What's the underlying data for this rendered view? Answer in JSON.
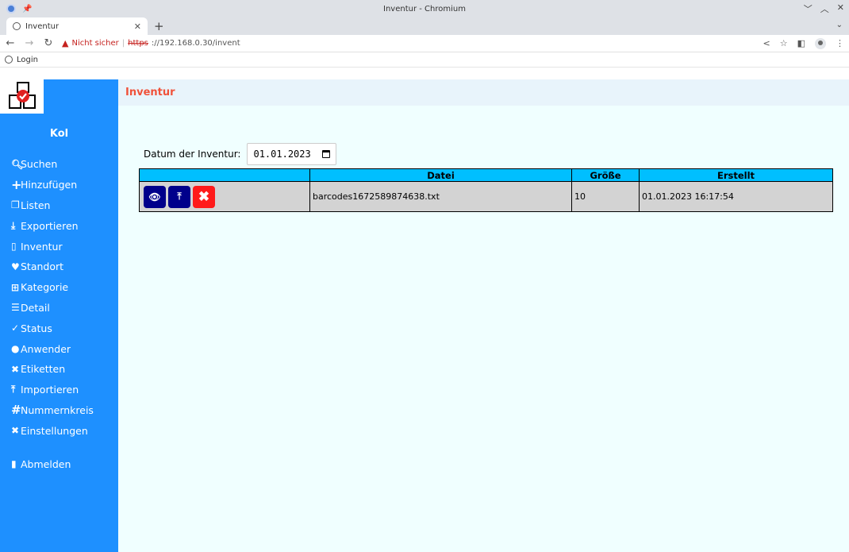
{
  "browser": {
    "window_title": "Inventur - Chromium",
    "tab_title": "Inventur",
    "not_secure": "Nicht sicher",
    "url_proto": "https",
    "url_rest": "://192.168.0.30/invent",
    "bookmark": "Login"
  },
  "sidebar": {
    "user": "Kol",
    "items": [
      {
        "label": "Suchen",
        "icon": "search-icon"
      },
      {
        "label": "Hinzufügen",
        "icon": "plus-icon"
      },
      {
        "label": "Listen",
        "icon": "copy-icon"
      },
      {
        "label": "Exportieren",
        "icon": "download-icon"
      },
      {
        "label": "Inventur",
        "icon": "clipboard-icon"
      },
      {
        "label": "Standort",
        "icon": "map-pin-icon"
      },
      {
        "label": "Kategorie",
        "icon": "grid-icon"
      },
      {
        "label": "Detail",
        "icon": "list-icon"
      },
      {
        "label": "Status",
        "icon": "check-icon"
      },
      {
        "label": "Anwender",
        "icon": "user-icon"
      },
      {
        "label": "Etiketten",
        "icon": "tools-icon"
      },
      {
        "label": "Importieren",
        "icon": "upload-icon"
      },
      {
        "label": "Nummernkreis",
        "icon": "hash-icon"
      },
      {
        "label": "Einstellungen",
        "icon": "tools-icon"
      }
    ],
    "logout": "Abmelden"
  },
  "main": {
    "title": "Inventur",
    "date_label": "Datum der Inventur:",
    "date_value": "01.01.2023",
    "table": {
      "columns": [
        "",
        "Datei",
        "Größe",
        "Erstellt"
      ],
      "rows": [
        {
          "file": "barcodes1672589874638.txt",
          "size": "10",
          "created": "01.01.2023 16:17:54"
        }
      ]
    }
  },
  "colors": {
    "sidebar": "#1e90ff",
    "title": "#f0523a",
    "header_cell": "#00bfff",
    "button_dark": "#00008b",
    "button_delete": "#ff1a1a"
  }
}
